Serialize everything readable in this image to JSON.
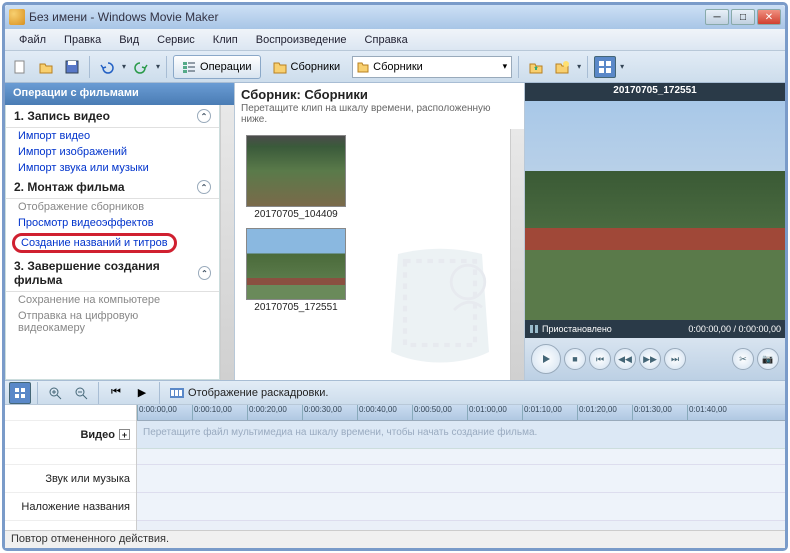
{
  "window": {
    "title": "Без имени - Windows Movie Maker"
  },
  "menu": {
    "file": "Файл",
    "edit": "Правка",
    "view": "Вид",
    "service": "Сервис",
    "clip": "Клип",
    "playback": "Воспроизведение",
    "help": "Справка"
  },
  "toolbar": {
    "operations": "Операции",
    "collections": "Сборники",
    "combo": "Сборники"
  },
  "tasks": {
    "header": "Операции с фильмами",
    "s1": {
      "title": "1. Запись видео",
      "l1": "Импорт видео",
      "l2": "Импорт изображений",
      "l3": "Импорт звука или музыки"
    },
    "s2": {
      "title": "2. Монтаж фильма",
      "l1": "Отображение сборников",
      "l2": "Просмотр видеоэффектов",
      "l3": "Создание названий и титров"
    },
    "s3": {
      "title": "3. Завершение создания фильма",
      "l1": "Сохранение на компьютере",
      "l2": "Отправка на цифровую видеокамеру"
    }
  },
  "collection": {
    "title": "Сборник: Сборники",
    "hint": "Перетащите клип на шкалу времени, расположенную ниже.",
    "thumb1": "20170705_104409",
    "thumb2": "20170705_172551"
  },
  "preview": {
    "title": "20170705_172551",
    "status": "Приостановлено",
    "time": "0:00:00,00 / 0:00:00,00"
  },
  "timeline": {
    "info": "Отображение раскадровки.",
    "ticks": [
      "0:00:00,00",
      "0:00:10,00",
      "0:00:20,00",
      "0:00:30,00",
      "0:00:40,00",
      "0:00:50,00",
      "0:01:00,00",
      "0:01:10,00",
      "0:01:20,00",
      "0:01:30,00",
      "0:01:40,00"
    ],
    "hint": "Перетащите файл мультимедиа на шкалу времени, чтобы начать создание фильма.",
    "video": "Видео",
    "audio": "Звук или музыка",
    "overlay": "Наложение названия"
  },
  "status": "Повтор отмененного действия."
}
